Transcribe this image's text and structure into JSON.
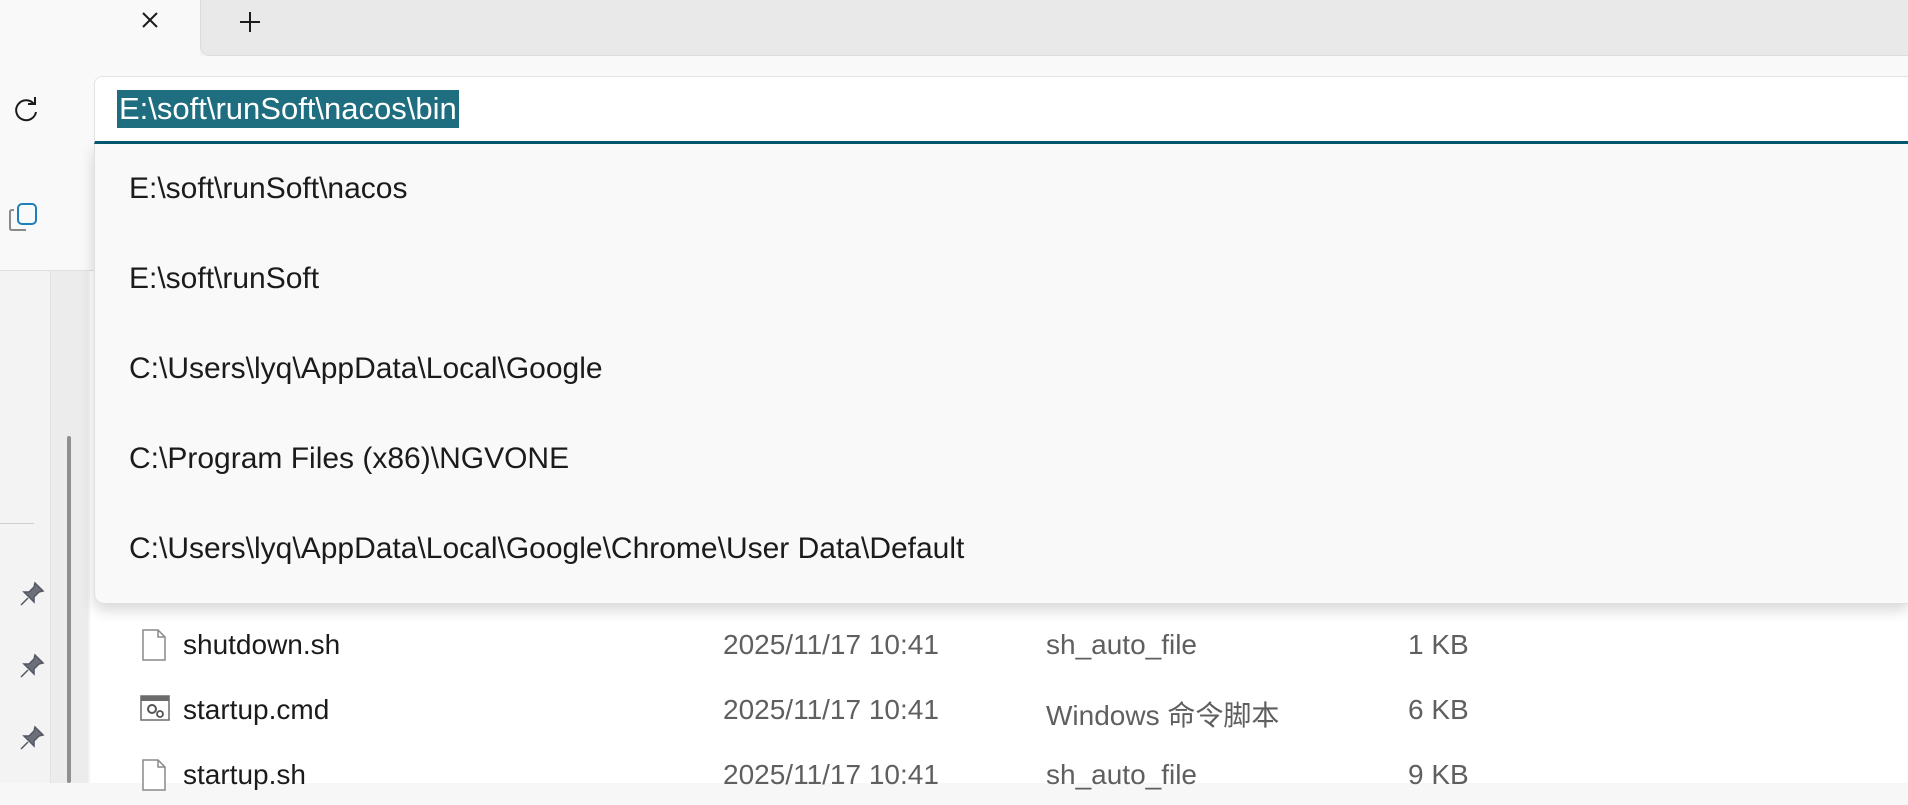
{
  "address_bar": {
    "path": "E:\\soft\\runSoft\\nacos\\bin"
  },
  "suggestions": [
    {
      "path": "E:\\soft\\runSoft\\nacos"
    },
    {
      "path": "E:\\soft\\runSoft"
    },
    {
      "path": "C:\\Users\\lyq\\AppData\\Local\\Google"
    },
    {
      "path": "C:\\Program Files (x86)\\NGVONE"
    },
    {
      "path": "C:\\Users\\lyq\\AppData\\Local\\Google\\Chrome\\User Data\\Default"
    }
  ],
  "files": [
    {
      "name": "shutdown.sh",
      "date": "2025/11/17 10:41",
      "type": "sh_auto_file",
      "size": "1 KB",
      "icon": "blank-file-icon"
    },
    {
      "name": "startup.cmd",
      "date": "2025/11/17 10:41",
      "type": "Windows 命令脚本",
      "size": "6 KB",
      "icon": "script-file-icon"
    },
    {
      "name": "startup.sh",
      "date": "2025/11/17 10:41",
      "type": "sh_auto_file",
      "size": "9 KB",
      "icon": "blank-file-icon"
    }
  ],
  "icons": {
    "tab_close": "close-icon",
    "new_tab": "plus-icon",
    "refresh": "refresh-icon",
    "copy": "copy-icon",
    "pin": "pin-icon"
  },
  "colors": {
    "accent": "#005a70",
    "selection": "#1f6e80"
  }
}
